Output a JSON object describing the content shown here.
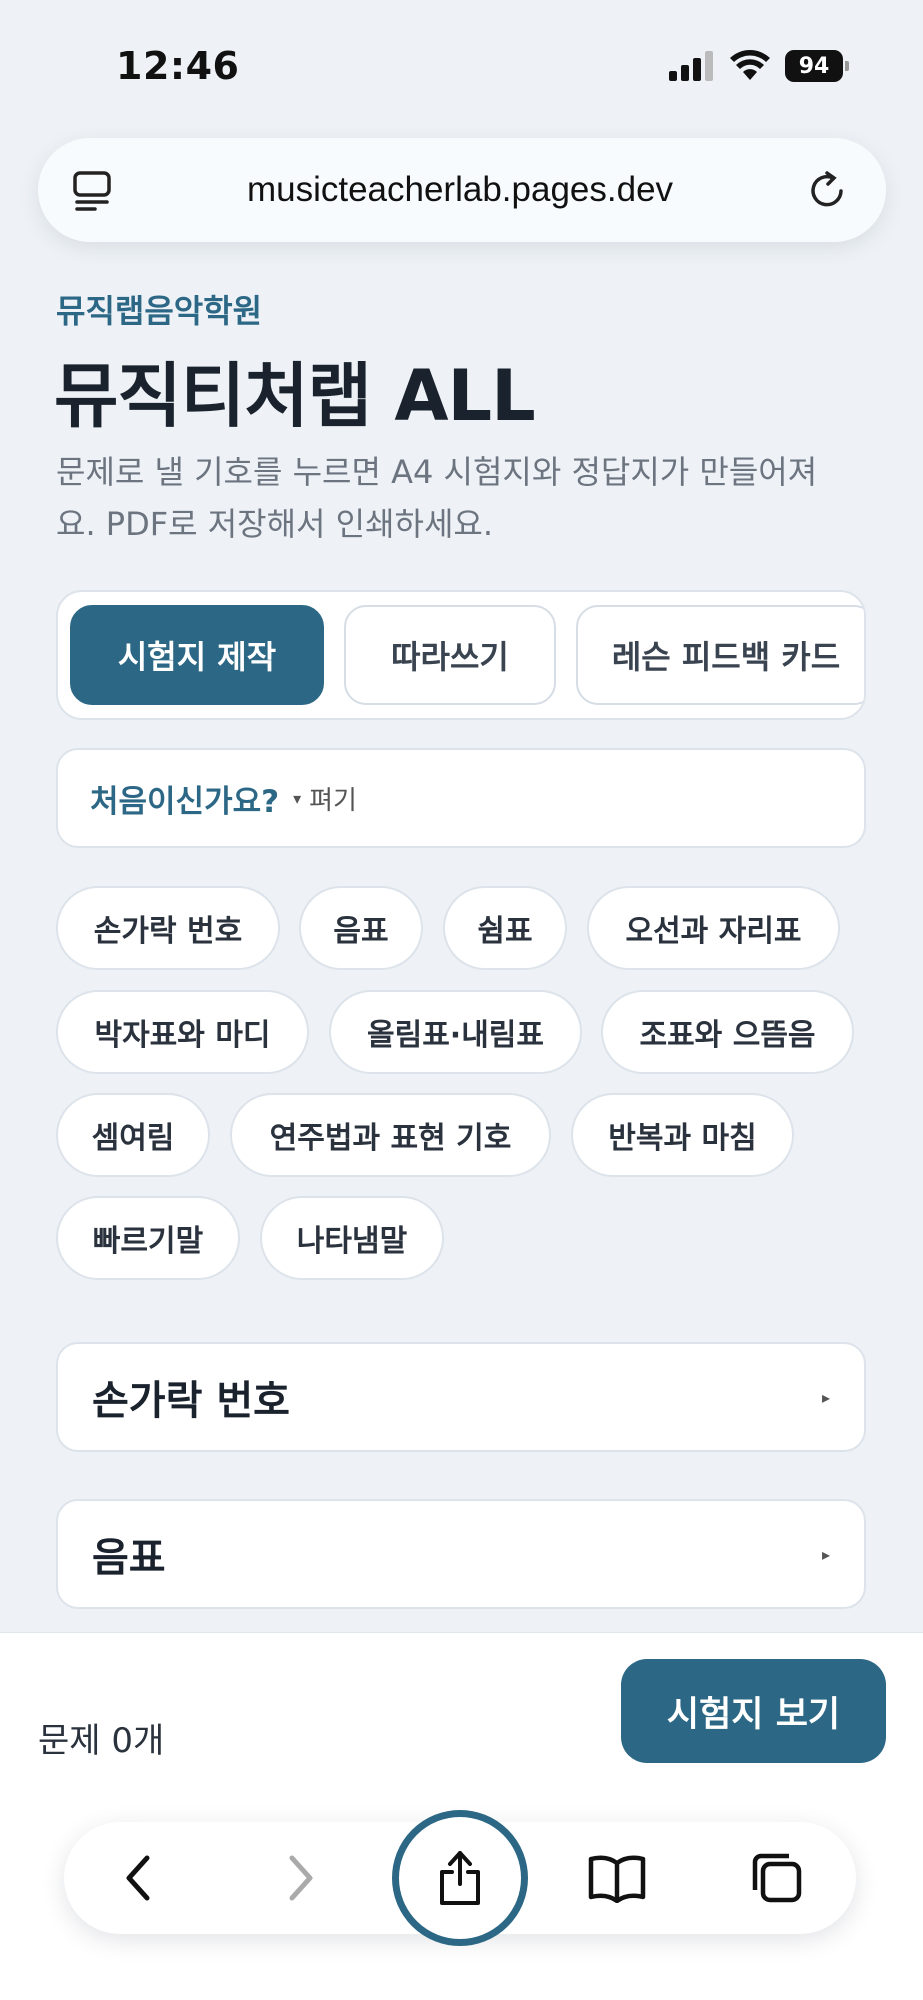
{
  "status": {
    "time": "12:46",
    "battery": "94"
  },
  "browser": {
    "url": "musicteacherlab.pages.dev"
  },
  "header": {
    "academy": "뮤직랩음악학원",
    "title": "뮤직티처랩 ALL",
    "description": "문제로 낼 기호를 누르면 A4 시험지와 정답지가 만들어져요. PDF로 저장해서 인쇄하세요."
  },
  "tabs": [
    {
      "label": "시험지 제작",
      "active": true
    },
    {
      "label": "따라쓰기",
      "active": false
    },
    {
      "label": "레슨 피드백 카드",
      "active": false
    }
  ],
  "intro": {
    "title": "처음이신가요?",
    "caret": "▾",
    "toggle": "펴기"
  },
  "chips": [
    {
      "label": "손가락 번호"
    },
    {
      "label": "음표"
    },
    {
      "label": "쉼표"
    },
    {
      "label": "오선과 자리표"
    },
    {
      "label": "박자표와 마디"
    },
    {
      "label": "올림표·내림표"
    },
    {
      "label": "조표와 으뜸음"
    },
    {
      "label": "셈여림"
    },
    {
      "label": "연주법과 표현 기호"
    },
    {
      "label": "반복과 마침"
    },
    {
      "label": "빠르기말"
    },
    {
      "label": "나타냄말"
    }
  ],
  "sections": [
    {
      "title": "손가락 번호",
      "arrow": "▸"
    },
    {
      "title": "음표",
      "arrow": "▸"
    }
  ],
  "footer": {
    "question_count": "문제 0개",
    "view_button": "시험지 보기"
  },
  "colors": {
    "accent": "#2c6886",
    "background": "#eef2f6"
  },
  "icons": {
    "url_left": "reader-icon",
    "url_right": "reload-icon",
    "toolbar": [
      "back-icon",
      "forward-icon",
      "share-icon",
      "bookmarks-icon",
      "tabs-icon"
    ]
  }
}
